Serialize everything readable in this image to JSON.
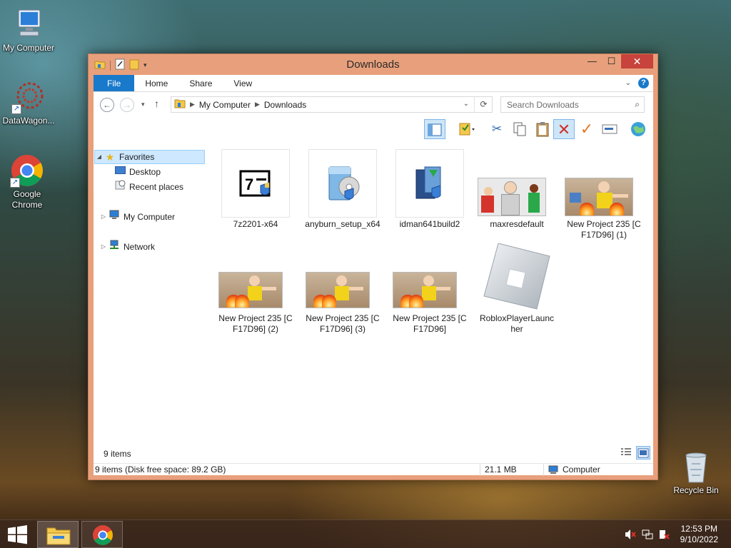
{
  "desktop": {
    "icons": [
      {
        "label": "My Computer"
      },
      {
        "label": "DataWagon..."
      },
      {
        "label": "Google Chrome"
      },
      {
        "label": "Recycle Bin"
      }
    ]
  },
  "window": {
    "title": "Downloads",
    "controls": {
      "minimize": "—",
      "maximize": "☐",
      "close": "✕"
    }
  },
  "ribbon": {
    "tabs": [
      {
        "label": "File"
      },
      {
        "label": "Home"
      },
      {
        "label": "Share"
      },
      {
        "label": "View"
      }
    ]
  },
  "address": {
    "breadcrumb": [
      "My Computer",
      "Downloads"
    ],
    "search_placeholder": "Search Downloads"
  },
  "navigation": {
    "favorites": "Favorites",
    "desktop": "Desktop",
    "recent": "Recent places",
    "computer": "My Computer",
    "network": "Network"
  },
  "files": [
    {
      "name": "7z2201-x64",
      "kind": "installer-7z"
    },
    {
      "name": "anyburn_setup_x64",
      "kind": "installer-anyburn"
    },
    {
      "name": "idman641build2",
      "kind": "installer-idm"
    },
    {
      "name": "maxresdefault",
      "kind": "image"
    },
    {
      "name": "New Project 235 [CF17D96] (1)",
      "kind": "image"
    },
    {
      "name": "New Project 235 [CF17D96] (2)",
      "kind": "image"
    },
    {
      "name": "New Project 235 [CF17D96] (3)",
      "kind": "image"
    },
    {
      "name": "New Project 235 [CF17D96]",
      "kind": "image"
    },
    {
      "name": "RobloxPlayerLauncher",
      "kind": "roblox"
    }
  ],
  "status": {
    "item_count": "9 items",
    "disk_info": "9 items (Disk free space: 89.2 GB)",
    "size": "21.1 MB",
    "location": "Computer"
  },
  "taskbar": {
    "time": "12:53 PM",
    "date": "9/10/2022"
  },
  "colors": {
    "window_frame": "#e8a07c",
    "file_tab": "#1979ca",
    "close_button": "#c7433c"
  }
}
